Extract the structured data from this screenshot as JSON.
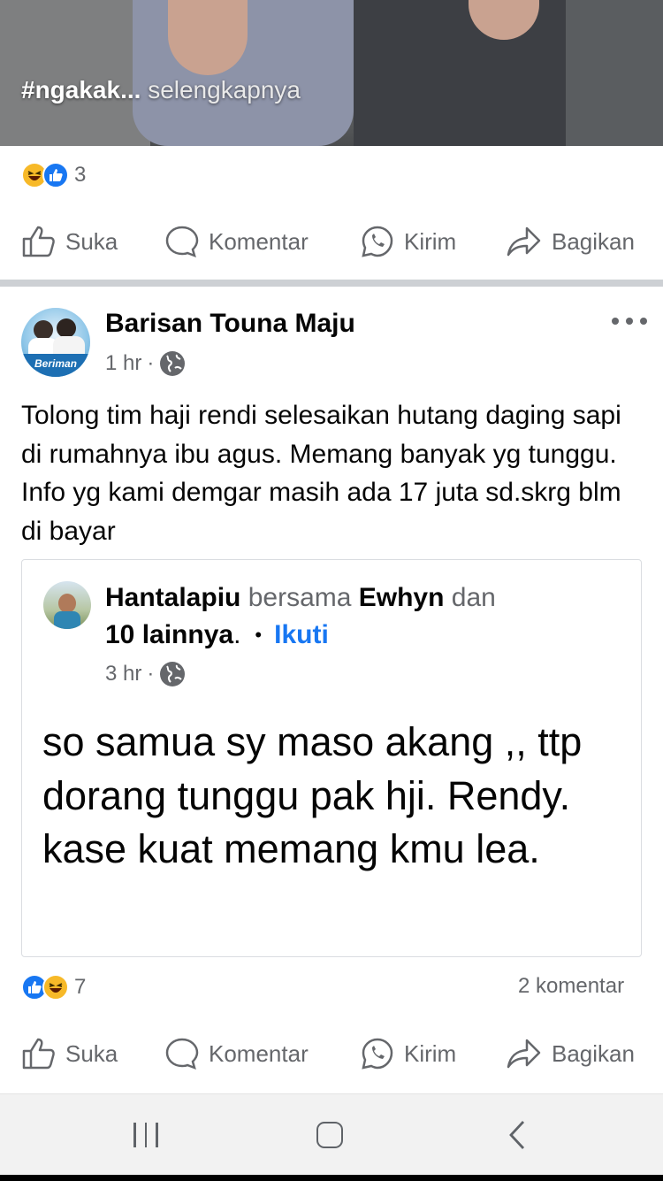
{
  "top_post": {
    "caption_hashtag": "#ngakak...",
    "caption_more": "selengkapnya",
    "reaction_count": "3"
  },
  "actions": {
    "like": "Suka",
    "comment": "Komentar",
    "send": "Kirim",
    "share": "Bagikan"
  },
  "post": {
    "author": "Barisan Touna Maju",
    "avatar_banner": "Beriman",
    "time": "1 hr",
    "dot": "·",
    "text": "Tolong tim haji rendi selesaikan hutang daging sapi di rumahnya ibu agus. Memang banyak yg tunggu. Info yg kami demgar masih ada 17 juta sd.skrg blm di bayar",
    "reaction_count": "7",
    "comment_count": "2 komentar"
  },
  "shared": {
    "author": "Hantalapiu",
    "with_word": "bersama",
    "tagged": "Ewhyn",
    "and_word": "dan",
    "others": "10 lainnya",
    "period": ".",
    "bullet": "•",
    "follow": "Ikuti",
    "time": "3 hr",
    "dot": "·",
    "text": "so samua sy maso akang ,, ttp dorang tunggu pak hji. Rendy. kase kuat memang kmu lea."
  },
  "colors": {
    "accent": "#1877f2",
    "secondary_text": "#65676b",
    "divider": "#cdd0d4",
    "haha": "#f7b928"
  },
  "icons": [
    "like-icon",
    "comment-icon",
    "whatsapp-icon",
    "share-icon",
    "globe-icon",
    "more-icon",
    "haha-reaction-icon",
    "like-reaction-icon"
  ]
}
